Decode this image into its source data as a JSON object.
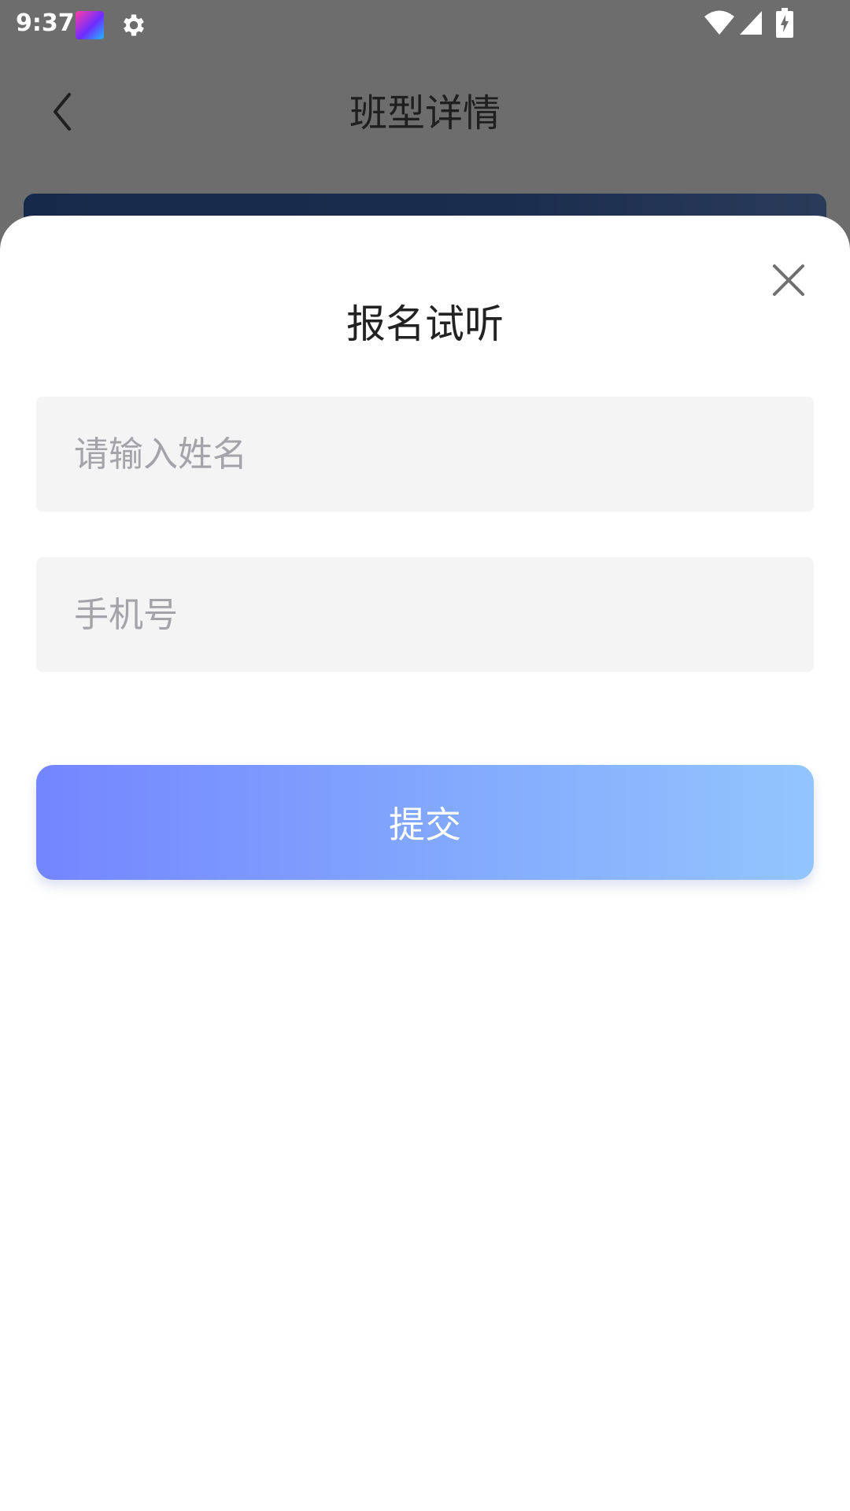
{
  "status_bar": {
    "time": "9:37",
    "icons": [
      "notification-app-icon",
      "gear-icon",
      "wifi-icon",
      "signal-icon",
      "battery-charging-icon"
    ]
  },
  "header": {
    "title": "班型详情",
    "back_icon": "chevron-left-icon"
  },
  "sheet": {
    "title": "报名试听",
    "close_icon": "close-icon",
    "name_placeholder": "请输入姓名",
    "phone_placeholder": "手机号",
    "submit_label": "提交"
  },
  "colors": {
    "overlay": "#6d6d6d",
    "input_bg": "#f4f4f5",
    "placeholder": "#a3a3a8",
    "button_gradient_start": "#7485fe",
    "button_gradient_end": "#93c5fd"
  }
}
